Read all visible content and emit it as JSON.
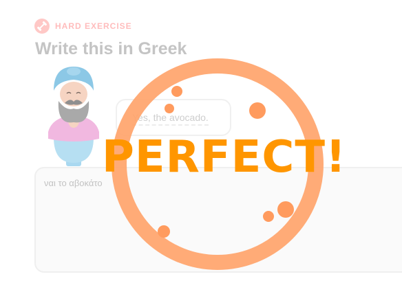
{
  "header": {
    "exercise_label": "HARD EXERCISE",
    "badge_icon": "dumbbell-icon",
    "prompt_title": "Write this in Greek"
  },
  "speech": {
    "text": "Yes, the avocado."
  },
  "answer": {
    "value": "ναι το αβοκάτο"
  },
  "overlay": {
    "stamp_text": "PERFECT!",
    "stamp_color": "#ff9600",
    "ring_color": "#ffa46b",
    "confetti_color": "#ff9b5e"
  },
  "colors": {
    "badge_bg": "#ffc8c6",
    "label_color": "#ffbcbc",
    "title_color": "#c4c4c4"
  }
}
